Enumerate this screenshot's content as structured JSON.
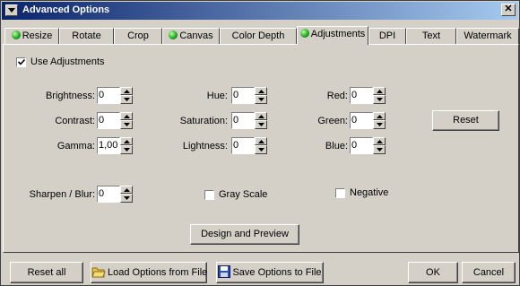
{
  "window": {
    "title": "Advanced Options"
  },
  "tabs": [
    {
      "label": "Resize",
      "dot": true
    },
    {
      "label": "Rotate",
      "dot": false
    },
    {
      "label": "Crop",
      "dot": false
    },
    {
      "label": "Canvas",
      "dot": true
    },
    {
      "label": "Color Depth",
      "dot": false
    },
    {
      "label": "Adjustments",
      "dot": true,
      "active": true
    },
    {
      "label": "DPI",
      "dot": false
    },
    {
      "label": "Text",
      "dot": false
    },
    {
      "label": "Watermark",
      "dot": false
    }
  ],
  "adjustments": {
    "use_label": "Use Adjustments",
    "use_checked": true,
    "brightness": {
      "label": "Brightness:",
      "value": "0"
    },
    "contrast": {
      "label": "Contrast:",
      "value": "0"
    },
    "gamma": {
      "label": "Gamma:",
      "value": "1,00"
    },
    "hue": {
      "label": "Hue:",
      "value": "0"
    },
    "saturation": {
      "label": "Saturation:",
      "value": "0"
    },
    "lightness": {
      "label": "Lightness:",
      "value": "0"
    },
    "red": {
      "label": "Red:",
      "value": "0"
    },
    "green": {
      "label": "Green:",
      "value": "0"
    },
    "blue": {
      "label": "Blue:",
      "value": "0"
    },
    "sharpen": {
      "label": "Sharpen / Blur:",
      "value": "0"
    },
    "grayscale": {
      "label": "Gray Scale",
      "checked": false
    },
    "negative": {
      "label": "Negative",
      "checked": false
    },
    "reset_label": "Reset",
    "design_label": "Design and Preview"
  },
  "footer": {
    "reset_all": "Reset all",
    "load_options": "Load Options from File",
    "save_options": "Save Options to File",
    "ok": "OK",
    "cancel": "Cancel"
  },
  "colors": {
    "title_start": "#0a246a",
    "title_end": "#a6caf0",
    "face": "#d4d0c8",
    "status_dot": "#19a21b"
  }
}
